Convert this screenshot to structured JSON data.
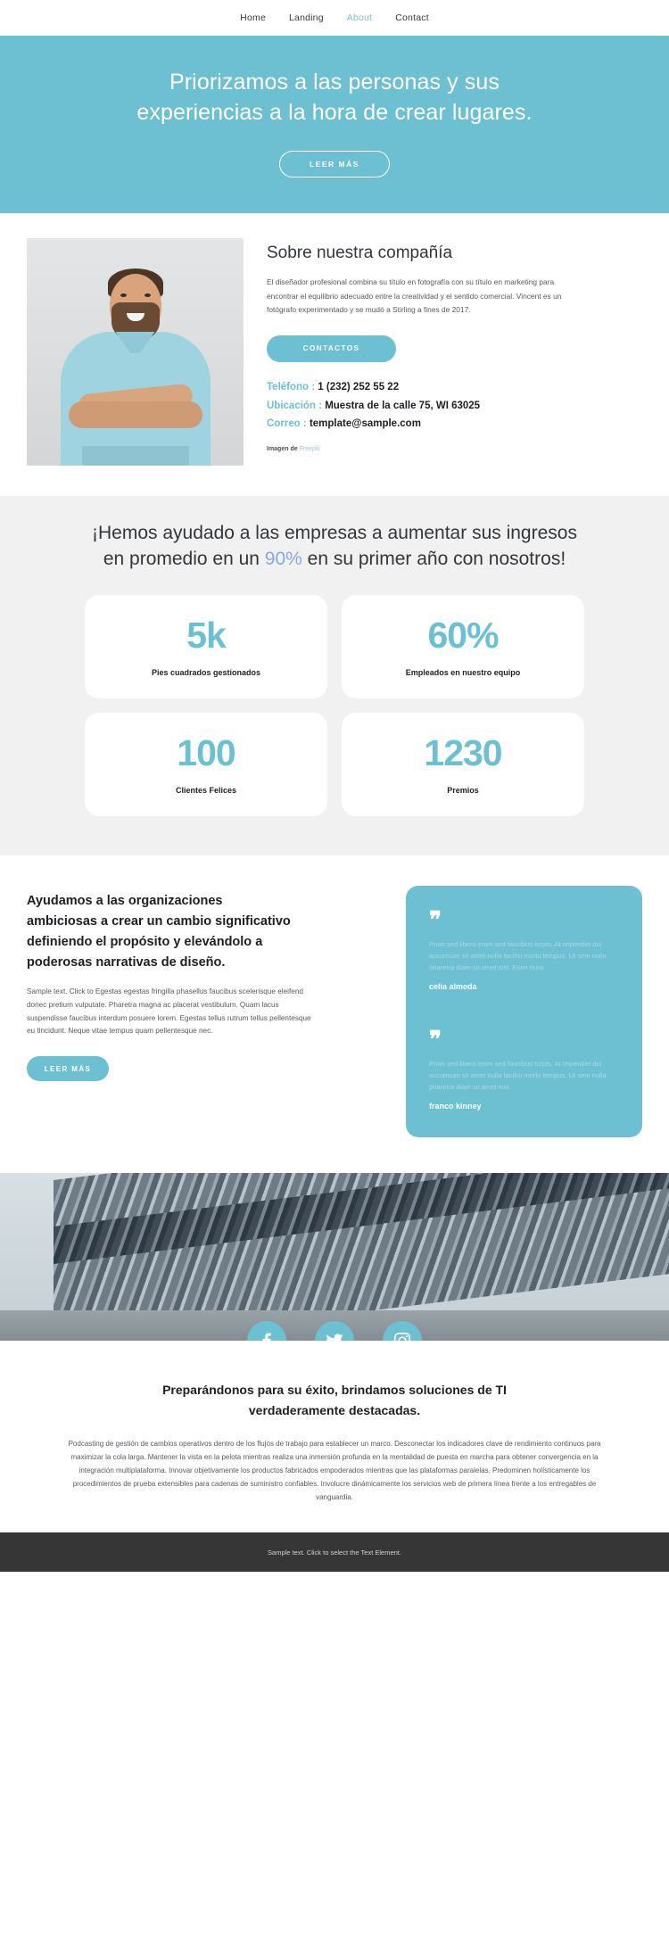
{
  "nav": {
    "items": [
      {
        "label": "Home",
        "active": false
      },
      {
        "label": "Landing",
        "active": false
      },
      {
        "label": "About",
        "active": true
      },
      {
        "label": "Contact",
        "active": false
      }
    ]
  },
  "hero": {
    "title": "Priorizamos a las personas y sus experiencias a la hora de crear lugares.",
    "button": "LEER MÁS",
    "bg_color": "#6dbfd2"
  },
  "about": {
    "title": "Sobre nuestra compañía",
    "text": "El diseñador profesional combina su título en fotografía con su título en marketing para encontrar el equilibrio adecuado entre la creatividad y el sentido comercial. Vincent es un fotógrafo experimentado y se mudó a Stirling a fines de 2017.",
    "button": "CONTACTOS",
    "contact": [
      {
        "label": "Teléfono",
        "sep": " : ",
        "value": "1 (232) 252 55 22"
      },
      {
        "label": "Ubicación",
        "sep": " : ",
        "value": "Muestra de la calle 75, WI 63025"
      },
      {
        "label": "Correo",
        "sep": " : ",
        "value": "template@sample.com"
      }
    ],
    "credit_prefix": "Imagen de",
    "credit_link": "Freepik"
  },
  "stats": {
    "title_part1": "¡Hemos ayudado a las empresas a aumentar sus ingresos en promedio en un ",
    "title_highlight": "90%",
    "title_part2": " en su primer año con nosotros!",
    "highlight_color": "#84a8e8",
    "cards": [
      {
        "number": "5k",
        "label": "Pies cuadrados gestionados"
      },
      {
        "number": "60%",
        "label": "Empleados en nuestro equipo"
      },
      {
        "number": "100",
        "label": "Clientes Felices"
      },
      {
        "number": "1230",
        "label": "Premios"
      }
    ]
  },
  "design": {
    "title": "Ayudamos a las organizaciones ambiciosas a crear un cambio significativo definiendo el propósito y elevándolo a poderosas narrativas de diseño.",
    "text": "Sample text. Click to Egestas egestas fringilla phasellus faucibus scelerisque eleifend donec pretium vulputate. Pharetra magna ac placerat vestibulum. Quam lacus suspendisse faucibus interdum posuere lorem. Egestas tellus rutrum tellus pellentesque eu tincidunt. Neque vitae tempus quam pellentesque nec.",
    "button": "LEER MÁS",
    "quote_mark": "❞",
    "quotes": [
      {
        "text": "Proin sed libero enim sed faucibus turpis. At imperdiet dui accumsan sit amet nulla facilisi morbi tempus. Ut sem nulla pharetra diam sit amet nisl. Enim nunc",
        "author": "celia almeda"
      },
      {
        "text": "Proin sed libero enim sed faucibus turpis. At imperdiet dui accumsan sit amet nulla facilisi morbi tempus. Ut sem nulla pharetra diam sit amet nisl.",
        "author": "franco kinney"
      }
    ]
  },
  "social": {
    "items": [
      {
        "name": "facebook-icon"
      },
      {
        "name": "twitter-icon"
      },
      {
        "name": "instagram-icon"
      }
    ]
  },
  "closing": {
    "title": "Preparándonos para su éxito, brindamos soluciones de TI verdaderamente destacadas.",
    "text": "Podcasting de gestión de cambios operativos dentro de los flujos de trabajo para establecer un marco. Desconectar los indicadores clave de rendimiento continuos para maximizar la cola larga. Mantener la vista en la pelota mientras realiza una inmersión profunda en la mentalidad de puesta en marcha para obtener convergencia en la integración multiplataforma. Innovar objetivamente los productos fabricados empoderados mientras que las plataformas paralelas. Predominen holísticamente los procedimientos de prueba extensibles para cadenas de suministro confiables. Involucre dinámicamente los servicios web de primera línea frente a los entregables de vanguardia."
  },
  "footer": {
    "text": "Sample text. Click to select the Text Element."
  }
}
